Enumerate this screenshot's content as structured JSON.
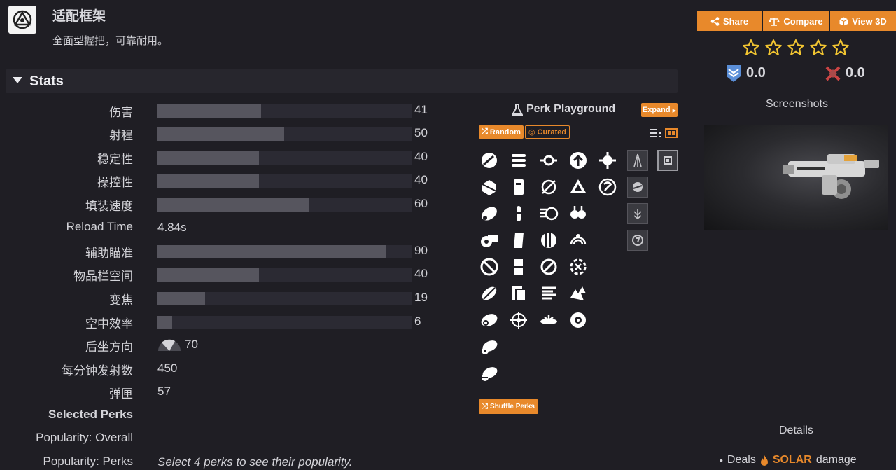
{
  "header": {
    "title": "适配框架",
    "description": "全面型握把，可靠耐用。"
  },
  "stats": {
    "section_label": "Stats",
    "bars": [
      {
        "name": "伤害",
        "value": 41
      },
      {
        "name": "射程",
        "value": 50
      },
      {
        "name": "稳定性",
        "value": 40
      },
      {
        "name": "操控性",
        "value": 40
      },
      {
        "name": "填装速度",
        "value": 60
      }
    ],
    "reload_time": {
      "name": "Reload Time",
      "value": "4.84s"
    },
    "bars2": [
      {
        "name": "辅助瞄准",
        "value": 90
      },
      {
        "name": "物品栏空间",
        "value": 40
      },
      {
        "name": "变焦",
        "value": 19
      },
      {
        "name": "空中效率",
        "value": 6
      }
    ],
    "recoil": {
      "name": "后坐方向",
      "value": 70
    },
    "rpm": {
      "name": "每分钟发射数",
      "value": "450"
    },
    "magazine": {
      "name": "弹匣",
      "value": "57"
    },
    "selected_perks_label": "Selected Perks",
    "popularity_overall_label": "Popularity: Overall",
    "popularity_perks_label": "Popularity: Perks",
    "popularity_perks_note": "Select 4 perks to see their popularity."
  },
  "perk_playground": {
    "title": "Perk Playground",
    "expand_label": "Expand",
    "random_label": "Random",
    "curated_label": "Curated",
    "shuffle_label": "Shuffle Perks"
  },
  "sidebar": {
    "share_label": "Share",
    "compare_label": "Compare",
    "view3d_label": "View 3D",
    "pvp_rating": "0.0",
    "pve_rating": "0.0",
    "star_count": 5,
    "star_rating": 0,
    "screenshots_label": "Screenshots",
    "details_label": "Details",
    "details": {
      "prefix": "Deals",
      "element": "SOLAR",
      "suffix": "damage"
    }
  },
  "colors": {
    "accent": "#e8892b",
    "background": "#1f1e24",
    "bar_fill": "#56555e",
    "bar_track": "#2b2a33"
  }
}
